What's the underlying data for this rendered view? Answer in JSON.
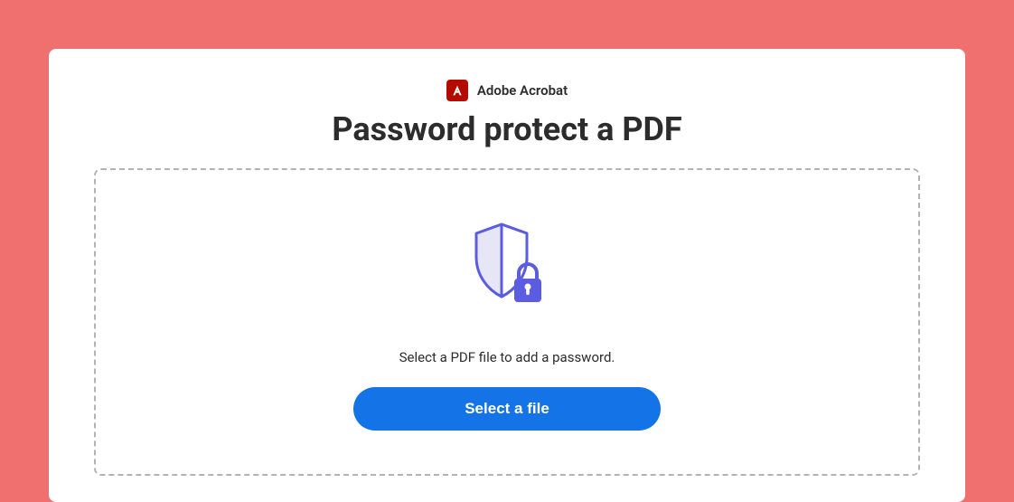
{
  "brand": {
    "icon": "adobe-acrobat-icon",
    "label": "Adobe Acrobat"
  },
  "title": "Password protect a PDF",
  "dropzone": {
    "illustration": "shield-lock-icon",
    "instruction": "Select a PDF file to add a password.",
    "button_label": "Select a file"
  },
  "colors": {
    "page_bg": "#f07070",
    "card_bg": "#ffffff",
    "brand_icon_bg": "#b30b00",
    "primary_button": "#1473e6",
    "illustration_stroke": "#5c5ce0",
    "illustration_fill": "#e6e6f7"
  }
}
